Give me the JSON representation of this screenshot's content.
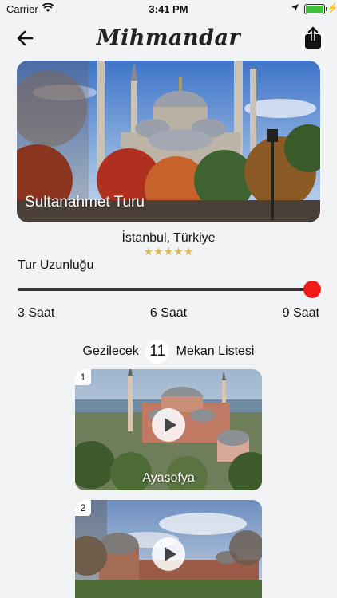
{
  "status_bar": {
    "carrier": "Carrier",
    "time": "3:41 PM"
  },
  "nav": {
    "title": "Mihmandar"
  },
  "hero": {
    "caption": "Sultanahmet Turu"
  },
  "tour": {
    "location": "İstanbul, Türkiye",
    "rating_stars": "★★★★★",
    "duration_label": "Tur Uzunluğu",
    "duration_level": 1.0,
    "duration_options": [
      "3 Saat",
      "6 Saat",
      "9 Saat"
    ]
  },
  "places": {
    "prefix": "Gezilecek",
    "count": "11",
    "suffix": "Mekan Listesi"
  },
  "cards": [
    {
      "index": "1",
      "name": "Ayasofya"
    },
    {
      "index": "2",
      "name": ""
    }
  ],
  "colors": {
    "slider_thumb": "#f21b1b",
    "stars": "#d8b85a",
    "battery": "#3cc13b"
  }
}
